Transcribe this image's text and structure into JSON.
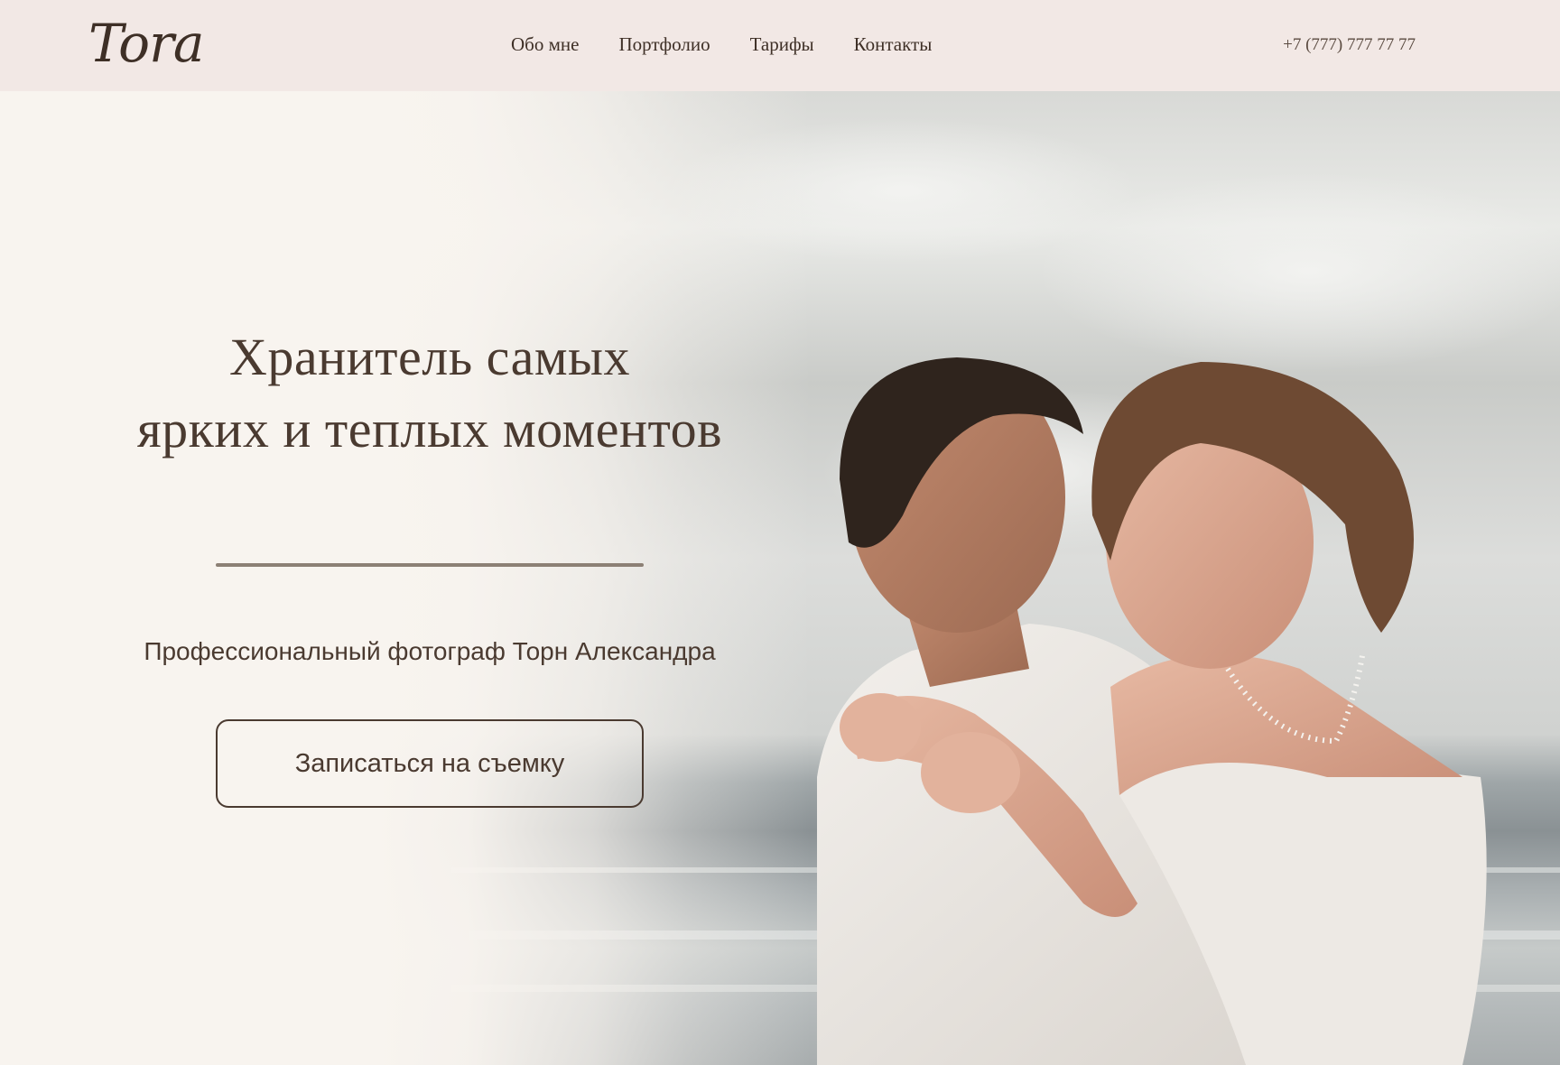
{
  "header": {
    "logo": "Tora",
    "nav": [
      "Обо мне",
      "Портфолио",
      "Тарифы",
      "Контакты"
    ],
    "phone": "+7 (777) 777 77 77"
  },
  "hero": {
    "title_line1": "Хранитель самых",
    "title_line2": "ярких и теплых моментов",
    "subtitle": "Профессиональный фотограф Торн Александра",
    "cta_label": "Записаться на съемку",
    "image_name": "couple-embracing-by-the-sea-photo"
  },
  "colors": {
    "header_bg": "#f2e8e5",
    "page_bg": "#f7f3ef",
    "text": "#4a3a30",
    "divider": "#8c8075"
  }
}
